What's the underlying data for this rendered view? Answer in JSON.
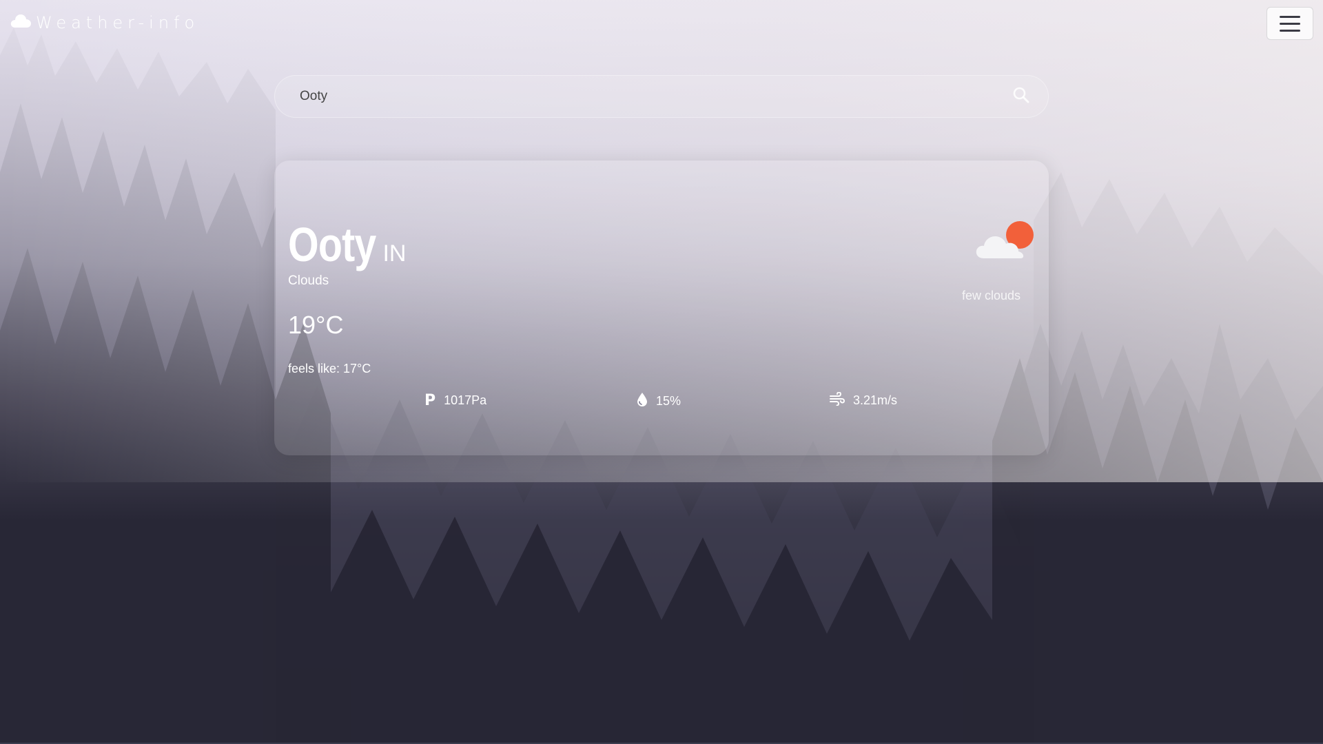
{
  "brand": {
    "title": "Weather-info",
    "icon": "cloud-icon"
  },
  "nav": {
    "menu_icon": "hamburger-menu-icon"
  },
  "search": {
    "value": "Ooty",
    "icon": "search-icon"
  },
  "weather": {
    "city": "Ooty",
    "country": "IN",
    "condition": "Clouds",
    "temperature": "19°C",
    "feels_like": "feels like: 17°C",
    "icon": "few-clouds-day-icon",
    "description": "few clouds",
    "pressure": "1017Pa",
    "pressure_icon": "pressure-p-icon",
    "humidity": "15%",
    "humidity_icon": "water-drop-icon",
    "wind": "3.21m/s",
    "wind_icon": "wind-icon"
  },
  "colors": {
    "sun": "#f2603a",
    "cloud": "#f4f4f6",
    "forest_dark": "#1e1e2a"
  }
}
